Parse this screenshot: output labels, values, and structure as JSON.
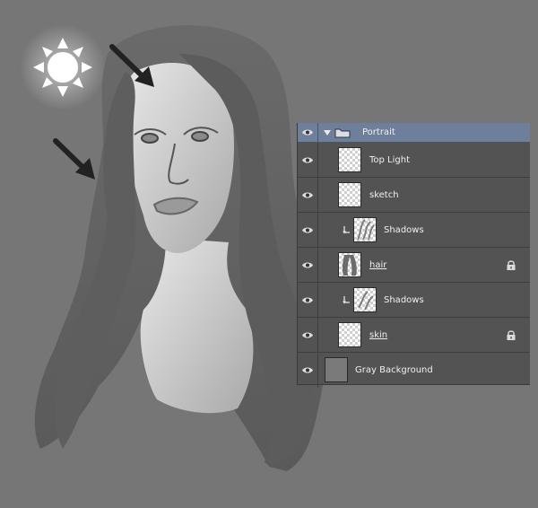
{
  "layers_panel": {
    "group": {
      "name": "Portrait",
      "expanded": true
    },
    "layers": [
      {
        "name": "Top Light",
        "indent": false,
        "clipped": false,
        "locked": false,
        "underline": false,
        "thumb": "transparent"
      },
      {
        "name": "sketch",
        "indent": false,
        "clipped": false,
        "locked": false,
        "underline": false,
        "thumb": "transparent"
      },
      {
        "name": "Shadows",
        "indent": true,
        "clipped": true,
        "locked": false,
        "underline": false,
        "thumb": "strokes"
      },
      {
        "name": "hair",
        "indent": false,
        "clipped": false,
        "locked": true,
        "underline": true,
        "thumb": "hair"
      },
      {
        "name": "Shadows",
        "indent": true,
        "clipped": true,
        "locked": false,
        "underline": false,
        "thumb": "strokes"
      },
      {
        "name": "skin",
        "indent": false,
        "clipped": false,
        "locked": true,
        "underline": true,
        "thumb": "transparent"
      },
      {
        "name": "Gray Background",
        "indent": false,
        "clipped": false,
        "locked": false,
        "underline": false,
        "thumb": "solid"
      }
    ]
  },
  "colors": {
    "canvas_bg": "#767676",
    "panel_bg": "#535353",
    "group_highlight": "#6d7f9a",
    "text": "#f0f0f0"
  },
  "icons": [
    "sun-icon",
    "arrow-icon",
    "eye-icon",
    "folder-icon",
    "clip-icon",
    "lock-icon"
  ]
}
